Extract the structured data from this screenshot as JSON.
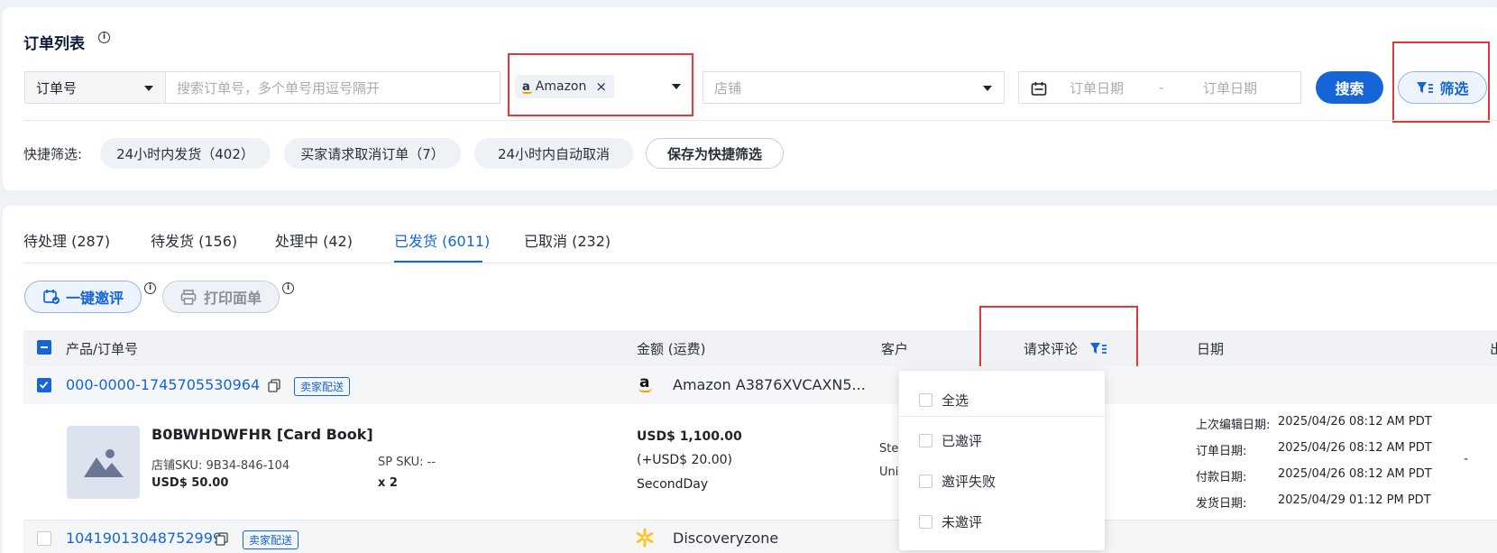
{
  "header": {
    "title": "订单列表",
    "info": "i"
  },
  "filters": {
    "order_type": "订单号",
    "search_placeholder": "搜索订单号，多个单号用逗号隔开",
    "platform_tag": "Amazon",
    "platform_tag_remove": "×",
    "store_placeholder": "店铺",
    "date_start_placeholder": "订单日期",
    "date_sep": "-",
    "date_end_placeholder": "订单日期",
    "search_label": "搜索",
    "filter_label": "筛选"
  },
  "quick": {
    "label": "快捷筛选:",
    "chips": [
      "24小时内发货（402）",
      "买家请求取消订单（7）",
      "24小时内自动取消"
    ],
    "save_label": "保存为快捷筛选"
  },
  "tabs": [
    {
      "label": "待处理 (287)"
    },
    {
      "label": "待发货 (156)"
    },
    {
      "label": "处理中 (42)"
    },
    {
      "label": "已发货 (6011)"
    },
    {
      "label": "已取消 (232)"
    }
  ],
  "actions": {
    "invite_label": "一键邀评",
    "print_label": "打印面单"
  },
  "table": {
    "columns": [
      "产品/订单号",
      "金额 (运费)",
      "客户",
      "请求评论",
      "日期",
      "出"
    ],
    "rows": [
      {
        "order_no": "000-0000-1745705530964",
        "tag": "卖家配送",
        "store": "Amazon A3876XVCAXN5...",
        "product": {
          "title": "B0BWHDWFHR [Card Book]",
          "store_sku": "店铺SKU: 9B34-846-104",
          "sp_sku": "SP SKU: --",
          "price": "USD$ 50.00",
          "qty": "x 2"
        },
        "amount": "USD$ 1,100.00",
        "shipping": "(+USD$ 20.00)",
        "ship_method": "SecondDay",
        "customer_1": "Ste",
        "customer_2": "Uni",
        "dates": [
          {
            "label": "上次编辑日期:",
            "value": "2025/04/26 08:12 AM PDT"
          },
          {
            "label": "订单日期:",
            "value": "2025/04/26 08:12 AM PDT"
          },
          {
            "label": "付款日期:",
            "value": "2025/04/26 08:12 AM PDT"
          },
          {
            "label": "发货日期:",
            "value": "2025/04/29 01:12 PM PDT"
          }
        ],
        "extra": "-"
      },
      {
        "order_no": "10419013048752999",
        "tag": "卖家配送",
        "store": "Discoveryzone"
      }
    ]
  },
  "review_filter": {
    "options": [
      "全选",
      "已邀评",
      "邀评失败",
      "未邀评"
    ]
  },
  "colors": {
    "accent": "#1565d8",
    "highlight": "#e53935",
    "amazon_orange": "#ff9900",
    "walmart_yellow": "#ffc220"
  }
}
